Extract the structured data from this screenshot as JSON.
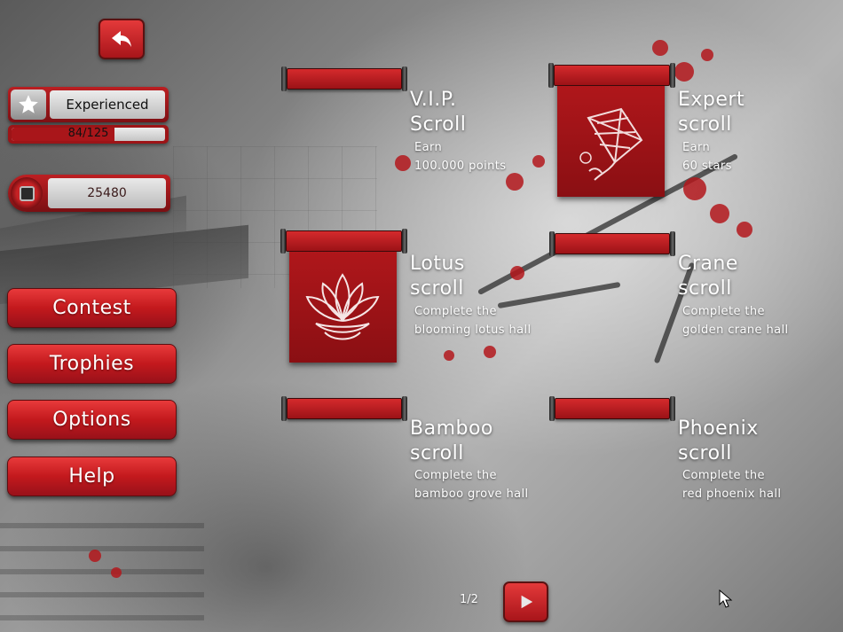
{
  "player": {
    "rank_label": "Experienced",
    "progress_text": "84/125",
    "progress_fraction": 0.672,
    "coins": "25480"
  },
  "menu": [
    {
      "label": "Contest"
    },
    {
      "label": "Trophies"
    },
    {
      "label": "Options"
    },
    {
      "label": "Help"
    }
  ],
  "scrolls": [
    {
      "title_line1": "V.I.P.",
      "title_line2": "Scroll",
      "desc_line1": "Earn",
      "desc_line2": "100.000 points",
      "unlocked": false
    },
    {
      "title_line1": "Expert",
      "title_line2": "scroll",
      "desc_line1": "Earn",
      "desc_line2": "60 stars",
      "unlocked": true,
      "emblem": "kite-icon"
    },
    {
      "title_line1": "Lotus",
      "title_line2": "scroll",
      "desc_line1": "Complete the",
      "desc_line2": "blooming lotus hall",
      "unlocked": true,
      "emblem": "lotus-icon"
    },
    {
      "title_line1": "Crane",
      "title_line2": "scroll",
      "desc_line1": "Complete the",
      "desc_line2": "golden crane hall",
      "unlocked": false
    },
    {
      "title_line1": "Bamboo",
      "title_line2": "scroll",
      "desc_line1": "Complete the",
      "desc_line2": "bamboo grove hall",
      "unlocked": false
    },
    {
      "title_line1": "Phoenix",
      "title_line2": "scroll",
      "desc_line1": "Complete the",
      "desc_line2": "red phoenix hall",
      "unlocked": false
    }
  ],
  "pager": {
    "indicator": "1/2"
  },
  "icons": {
    "back": "back-arrow-icon",
    "next": "play-arrow-icon",
    "rank": "star-icon",
    "coin": "coin-icon"
  },
  "colors": {
    "accent_red": "#c3191d",
    "panel_grey": "#e9e9e9",
    "text_white": "#ffffff"
  }
}
